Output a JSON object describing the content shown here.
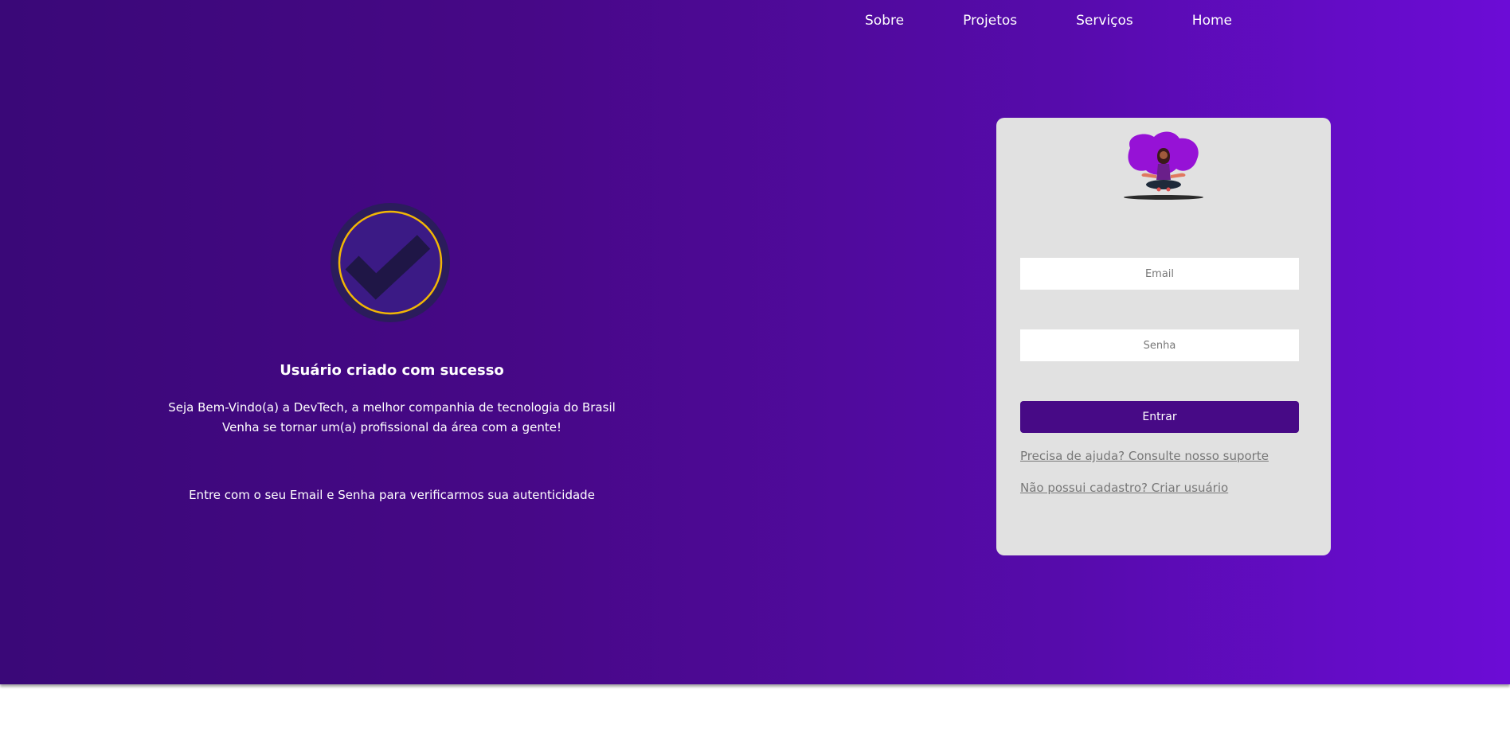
{
  "nav": {
    "items": [
      "Sobre",
      "Projetos",
      "Serviços",
      "Home"
    ]
  },
  "success": {
    "icon": "check-circle-icon",
    "title": "Usuário criado com sucesso",
    "line1": "Seja Bem-Vindo(a) a DevTech, a melhor companhia de tecnologia do Brasil",
    "line2": "Venha se tornar um(a) profissional da área com a gente!",
    "line3": "Entre com o seu Email e Senha para verificarmos sua autenticidade"
  },
  "login": {
    "illustration": "meditating-woman-illustration",
    "email_placeholder": "Email",
    "password_placeholder": "Senha",
    "submit_label": "Entrar",
    "help_link": "Precisa de ajuda? Consulte nosso suporte",
    "register_link": "Não possui cadastro? Criar usuário"
  },
  "colors": {
    "gradient_start": "#3a0878",
    "gradient_end": "#6c0cd6",
    "card_bg": "#e1e1e1",
    "button_bg": "#470a86",
    "check_ring": "#f2b705",
    "check_mark": "#1f1646"
  }
}
